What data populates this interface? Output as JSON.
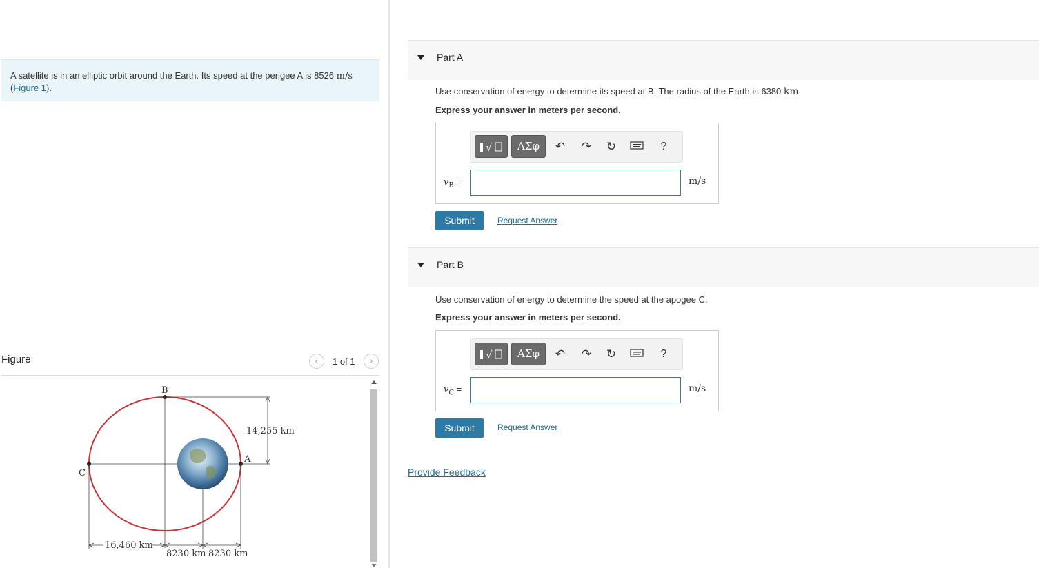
{
  "problem": {
    "text": "A satellite is in an elliptic orbit around the Earth. Its speed at the perigee A is 8526 ",
    "unit": "m/s",
    "link_open": "(",
    "link": "Figure 1",
    "link_close": ")."
  },
  "figure": {
    "title": "Figure",
    "pager": "1 of 1",
    "prev_icon": "chevron-left-icon",
    "next_icon": "chevron-right-icon",
    "labels": {
      "B": "B",
      "C": "C",
      "A": "A",
      "height": "14,255 km",
      "left_width": "16,460 km",
      "half1": "8230 km",
      "half2": "8230 km"
    },
    "colors": {
      "orbit": "#c8343a"
    }
  },
  "parts": [
    {
      "title": "Part A",
      "question": "Use conservation of energy to determine its speed at B. The radius of the Earth is 6380 ",
      "question_unit": "km",
      "question_end": ".",
      "instruction": "Express your answer in meters per second.",
      "var_main": "v",
      "var_sub": "B",
      "equals": " =",
      "input_value": "",
      "unit": "m/s",
      "submit": "Submit",
      "request": "Request Answer"
    },
    {
      "title": "Part B",
      "question": "Use conservation of energy to determine the speed at the apogee C.",
      "question_unit": "",
      "question_end": "",
      "instruction": "Express your answer in meters per second.",
      "var_main": "v",
      "var_sub": "C",
      "equals": " =",
      "input_value": "",
      "unit": "m/s",
      "submit": "Submit",
      "request": "Request Answer"
    }
  ],
  "toolbar": {
    "templates_icon": "templates-icon",
    "greek_label": "ΑΣφ",
    "undo_icon": "undo-icon",
    "redo_icon": "redo-icon",
    "reset_icon": "reset-icon",
    "keyboard_icon": "keyboard-icon",
    "help_label": "?"
  },
  "feedback": "Provide Feedback",
  "colors": {
    "accent": "#2c7aa6",
    "link": "#1a6e9a",
    "problem_bg": "#e9f5f8"
  }
}
